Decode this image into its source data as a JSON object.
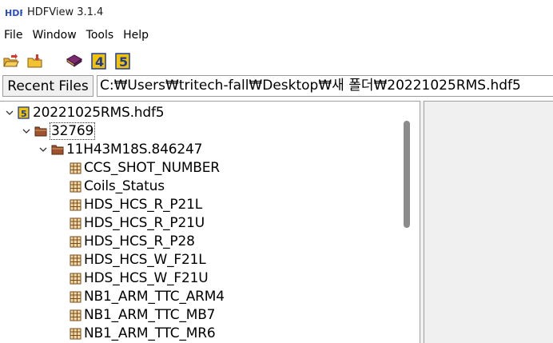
{
  "window": {
    "title": "HDFView 3.1.4",
    "logo_text": "HDF"
  },
  "menu": {
    "items": [
      "File",
      "Window",
      "Tools",
      "Help"
    ]
  },
  "toolbar": {
    "buttons": [
      "open-file-icon",
      "close-file-icon",
      "help-book-icon",
      "hdf4-library-icon",
      "hdf5-library-icon"
    ],
    "hdf4_glyph": "4",
    "hdf5_glyph": "5"
  },
  "pathbar": {
    "recent_files_label": "Recent Files",
    "path_value": "C:₩Users₩tritech-fall₩Desktop₩새 폴더₩20221025RMS.hdf5"
  },
  "tree": {
    "root": "20221025RMS.hdf5",
    "group": "32769",
    "subgroup": "11H43M18S.846247",
    "datasets": [
      "CCS_SHOT_NUMBER",
      "Coils_Status",
      "HDS_HCS_R_P21L",
      "HDS_HCS_R_P21U",
      "HDS_HCS_R_P28",
      "HDS_HCS_W_F21L",
      "HDS_HCS_W_F21U",
      "NB1_ARM_TTC_ARM4",
      "NB1_ARM_TTC_MB7",
      "NB1_ARM_TTC_MR6"
    ]
  }
}
